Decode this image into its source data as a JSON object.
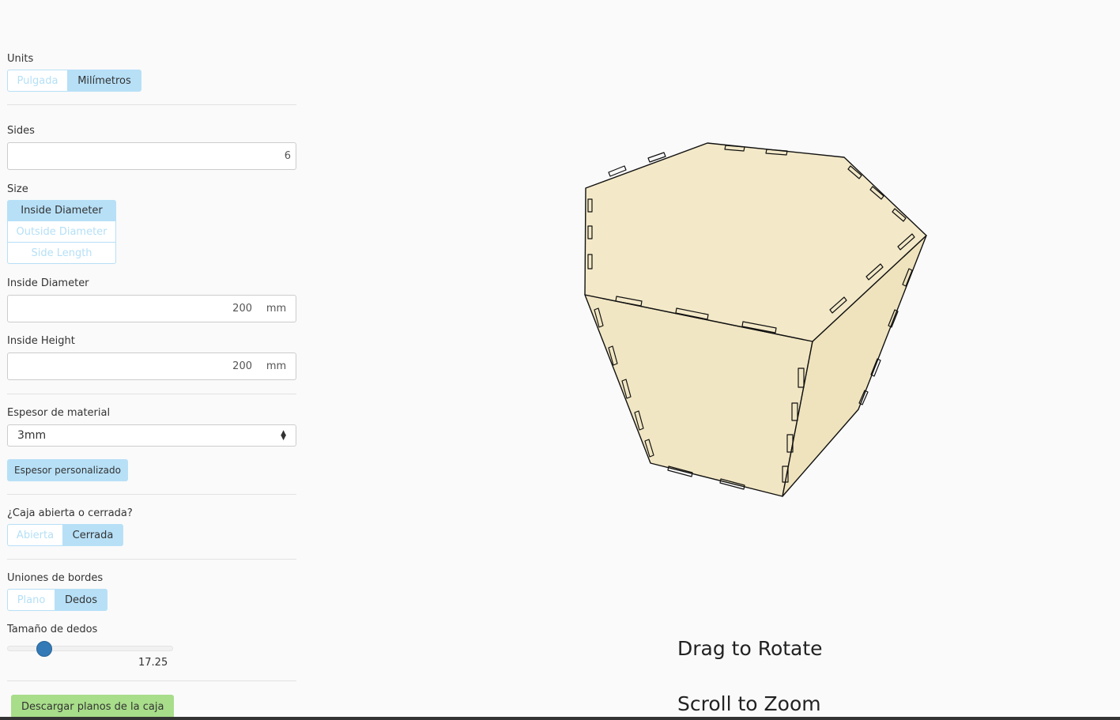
{
  "units": {
    "label": "Units",
    "options": [
      "Pulgada",
      "Milímetros"
    ],
    "selected": "Milímetros"
  },
  "sides": {
    "label": "Sides",
    "value": "6"
  },
  "size": {
    "label": "Size",
    "options": [
      "Inside Diameter",
      "Outside Diameter",
      "Side Length"
    ],
    "selected": "Inside Diameter"
  },
  "inside_diameter": {
    "label": "Inside Diameter",
    "value": "200",
    "unit": "mm"
  },
  "inside_height": {
    "label": "Inside Height",
    "value": "200",
    "unit": "mm"
  },
  "material": {
    "label": "Espesor de material",
    "selected": "3mm",
    "custom_button": "Espesor personalizado"
  },
  "open_closed": {
    "label": "¿Caja abierta o cerrada?",
    "options": [
      "Abierta",
      "Cerrada"
    ],
    "selected": "Cerrada"
  },
  "edge_joints": {
    "label": "Uniones de bordes",
    "options": [
      "Plano",
      "Dedos"
    ],
    "selected": "Dedos"
  },
  "finger_size": {
    "label": "Tamaño de dedos",
    "value": "17.25",
    "slider_fraction": 0.22
  },
  "download_button": "Descargar planos de la caja",
  "viewer": {
    "hint_rotate": "Drag to Rotate",
    "hint_zoom": "Scroll to Zoom",
    "box_color": "#f3e9c8",
    "edge_color": "#111111"
  }
}
